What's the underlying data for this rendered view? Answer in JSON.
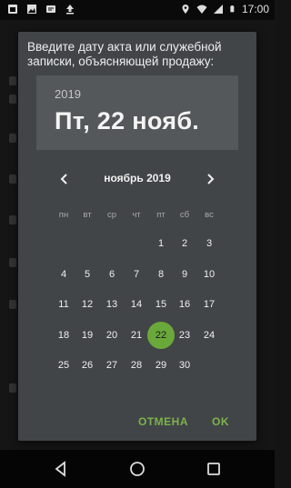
{
  "status_bar": {
    "time": "17:00",
    "left_icons": [
      "notification-icon",
      "image-icon",
      "message-icon",
      "upload-icon"
    ],
    "right_icons": [
      "location-icon",
      "wifi-icon",
      "signal-icon",
      "battery-icon"
    ]
  },
  "dialog": {
    "title": "Введите дату акта или служебной записки, объясняющей продажу:",
    "header": {
      "year": "2019",
      "date": "Пт, 22 нояб."
    },
    "calendar": {
      "month_label": "ноябрь 2019",
      "weekdays": [
        "пн",
        "вт",
        "ср",
        "чт",
        "пт",
        "сб",
        "вс"
      ],
      "first_weekday_index": 4,
      "days_in_month": 30,
      "selected_day": 22
    },
    "buttons": {
      "cancel": "ОТМЕНА",
      "ok": "OK"
    }
  },
  "colors": {
    "accent": "#6aa83a",
    "dialog_bg": "#424548",
    "header_bg": "#54585a"
  }
}
